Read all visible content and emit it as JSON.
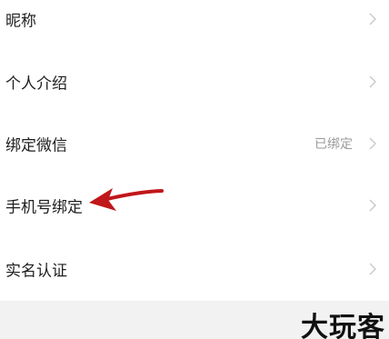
{
  "settings": {
    "rows": [
      {
        "label": "昵称",
        "value": ""
      },
      {
        "label": "个人介绍",
        "value": ""
      },
      {
        "label": "绑定微信",
        "value": "已绑定"
      },
      {
        "label": "手机号绑定",
        "value": ""
      },
      {
        "label": "实名认证",
        "value": ""
      }
    ]
  },
  "watermark": {
    "text": "大玩客"
  },
  "icons": {
    "row_chevron": "chevron-right-icon",
    "annotation": "red-arrow-icon"
  },
  "colors": {
    "annotation_arrow": "#c0171a",
    "chevron": "#c8c8c8",
    "value_text": "#9a9a9a",
    "bottom_band": "#f2f2f2"
  }
}
